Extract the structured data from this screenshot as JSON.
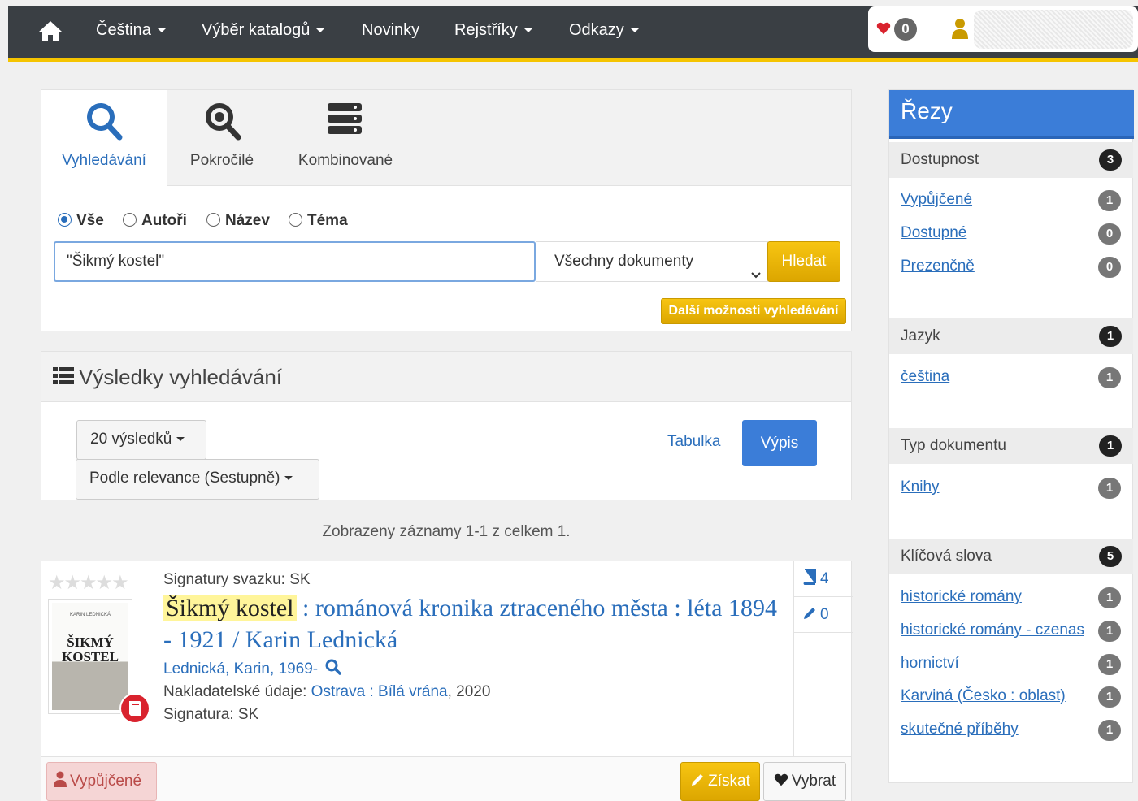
{
  "nav": {
    "items": [
      {
        "label": "Čeština",
        "dropdown": true
      },
      {
        "label": "Výběr katalogů",
        "dropdown": true
      },
      {
        "label": "Novinky",
        "dropdown": false
      },
      {
        "label": "Rejstříky",
        "dropdown": true
      },
      {
        "label": "Odkazy",
        "dropdown": true
      }
    ],
    "favorites_count": "0",
    "accent_color": "#f5c400"
  },
  "search": {
    "tabs": [
      {
        "label": "Vyhledávání",
        "icon": "search-icon",
        "active": true
      },
      {
        "label": "Pokročilé",
        "icon": "zoom-in-icon",
        "active": false
      },
      {
        "label": "Kombinované",
        "icon": "stack-icon",
        "active": false
      }
    ],
    "scopes": [
      {
        "label": "Vše",
        "checked": true
      },
      {
        "label": "Autoři",
        "checked": false
      },
      {
        "label": "Název",
        "checked": false
      },
      {
        "label": "Téma",
        "checked": false
      }
    ],
    "query": "\"Šikmý kostel\"",
    "doc_type": "Všechny dokumenty",
    "submit_label": "Hledat",
    "more_options_label": "Další možnosti vyhledávání"
  },
  "results": {
    "title": "Výsledky vyhledávání",
    "page_size_label": "20 výsledků",
    "sort_label": "Podle relevance (Sestupně)",
    "view_table_label": "Tabulka",
    "view_list_label": "Výpis",
    "summary": "Zobrazeny záznamy 1-1 z celkem 1."
  },
  "record": {
    "cover_small_text": "KARIN LEDNICKÁ",
    "cover_title": "ŠIKMÝ KOSTEL",
    "volume_signature": "Signatury svazku: SK",
    "title_highlight": "Šikmý kostel",
    "title_rest": " : románová kronika ztraceného města : léta 1894 - 1921 / Karin Lednická",
    "author": "Lednická, Karin, 1969-",
    "publisher_label": "Nakladatelské údaje: ",
    "publisher_place": "Ostrava",
    "publisher_sep": " : ",
    "publisher_name": "Bílá vrána",
    "publisher_year": ", 2020",
    "signature": "Signatura: SK",
    "copies_count": "4",
    "reviews_count": "0",
    "status_label": "Vypůjčené",
    "get_label": "Získat",
    "pick_label": "Vybrat",
    "rating": 0
  },
  "facets": {
    "title": "Řezy",
    "groups": [
      {
        "name": "Dostupnost",
        "count": "3",
        "items": [
          {
            "label": "Vypůjčené",
            "count": "1"
          },
          {
            "label": "Dostupné",
            "count": "0"
          },
          {
            "label": "Prezenčně",
            "count": "0"
          }
        ]
      },
      {
        "name": "Jazyk",
        "count": "1",
        "items": [
          {
            "label": "čeština",
            "count": "1"
          }
        ]
      },
      {
        "name": "Typ dokumentu",
        "count": "1",
        "items": [
          {
            "label": "Knihy",
            "count": "1"
          }
        ]
      },
      {
        "name": "Klíčová slova",
        "count": "5",
        "items": [
          {
            "label": "historické romány",
            "count": "1"
          },
          {
            "label": "historické romány - czenas",
            "count": "1"
          },
          {
            "label": "hornictví",
            "count": "1"
          },
          {
            "label": "Karviná (Česko : oblast)",
            "count": "1"
          },
          {
            "label": "skutečné příběhy",
            "count": "1"
          }
        ]
      }
    ]
  }
}
